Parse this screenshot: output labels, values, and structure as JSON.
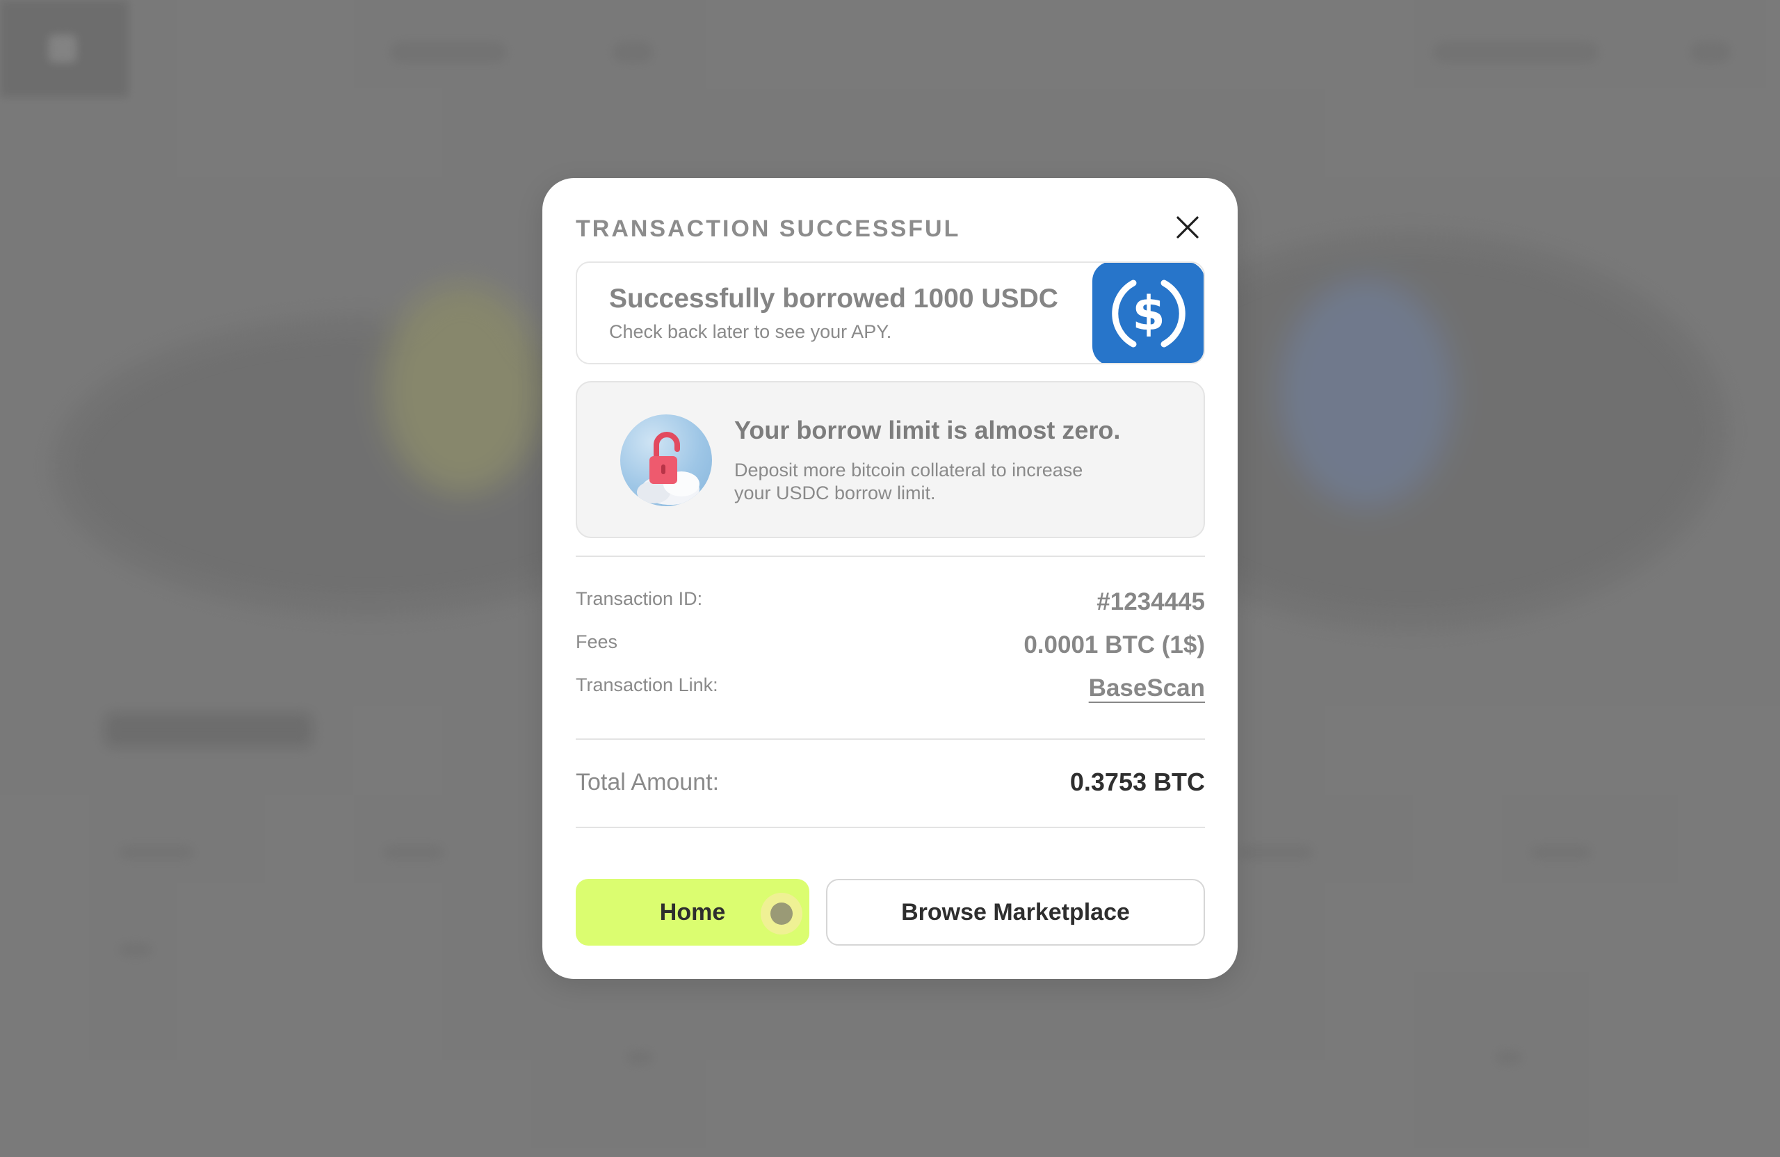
{
  "modal": {
    "title": "TRANSACTION SUCCESSFUL",
    "close_icon": "close-icon",
    "success": {
      "title": "Successfully borrowed 1000 USDC",
      "subtitle": "Check back later to see your APY.",
      "icon": "usdc-icon",
      "icon_color": "#2775ca"
    },
    "warning": {
      "title": "Your borrow limit is almost zero.",
      "body": "Deposit more bitcoin collateral to increase your USDC borrow limit.",
      "icon": "unlocked-padlock-icon"
    },
    "details": [
      {
        "label": "Transaction ID:",
        "value": "#1234445"
      },
      {
        "label": "Fees",
        "value": "0.0001 BTC (1$)"
      },
      {
        "label": "Transaction Link:",
        "value": "BaseScan"
      }
    ],
    "total": {
      "label": "Total Amount:",
      "value": "0.3753 BTC"
    },
    "buttons": {
      "home": "Home",
      "browse": "Browse Marketplace"
    }
  },
  "colors": {
    "accent": "#dbfd70",
    "usdc_blue": "#2775ca",
    "overlay": "#7b7b7b"
  }
}
